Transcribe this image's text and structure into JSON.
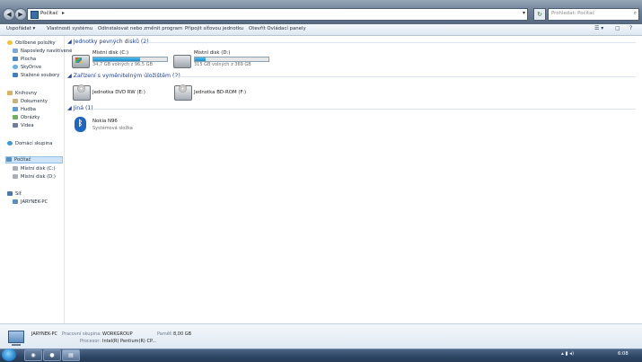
{
  "window": {
    "address": {
      "location": "Počítač",
      "separator": "▸",
      "dropdown": "▾"
    },
    "refresh_glyph": "↻",
    "search": {
      "placeholder": "Prohledat: Počítač",
      "icon": "search-icon"
    },
    "nav": {
      "back": "◀",
      "forward": "▶"
    }
  },
  "toolbar": {
    "items": [
      {
        "label": "Uspořádat ▾"
      },
      {
        "label": "Vlastnosti systému"
      },
      {
        "label": "Odinstalovat nebo změnit program"
      },
      {
        "label": "Připojit síťovou jednotku"
      },
      {
        "label": "Otevřít Ovládací panely"
      }
    ],
    "right": {
      "view": "☰ ▾",
      "preview": "▢",
      "help": "?"
    }
  },
  "sidebar": {
    "favorites": {
      "title": "Oblíbené položky",
      "items": [
        {
          "label": "Naposledy navštívené"
        },
        {
          "label": "Plocha"
        },
        {
          "label": "SkyDrive"
        },
        {
          "label": "Stažené soubory"
        }
      ]
    },
    "libraries": {
      "title": "Knihovny",
      "items": [
        {
          "label": "Dokumenty"
        },
        {
          "label": "Hudba"
        },
        {
          "label": "Obrázky"
        },
        {
          "label": "Videa"
        }
      ]
    },
    "homegroup": {
      "title": "Domácí skupina"
    },
    "computer": {
      "title": "Počítač",
      "items": [
        {
          "label": "Místní disk (C:)"
        },
        {
          "label": "Místní disk (D:)"
        }
      ]
    },
    "network": {
      "title": "Síť",
      "items": [
        {
          "label": "JARYNEK-PC"
        }
      ]
    }
  },
  "groups": {
    "hard_drives": {
      "header": "Jednotky pevných disků (2)",
      "drives": [
        {
          "name": "Místní disk (C:)",
          "free": "34,7 GB volných z 96,5 GB",
          "used_fraction": 0.64
        },
        {
          "name": "Místní disk (D:)",
          "free": "315 GB volných z 369 GB",
          "used_fraction": 0.15
        }
      ]
    },
    "removable": {
      "header": "Zařízení s vyměnitelným úložištěm (2)",
      "devices": [
        {
          "name": "Jednotka DVD RW (E:)"
        },
        {
          "name": "Jednotka BD-ROM (F:)"
        }
      ]
    },
    "other": {
      "header": "Jiná (1)",
      "items": [
        {
          "name": "Nokia N96",
          "type": "Systémová složka",
          "glyph": "ᛒ"
        }
      ]
    }
  },
  "details": {
    "computer_name": "JARYNEK-PC",
    "workgroup_label": "Pracovní skupina:",
    "workgroup": "WORKGROUP",
    "memory_label": "Paměť:",
    "memory": "8,00 GB",
    "processor_label": "Procesor:",
    "processor": "Intel(R) Pentium(R) CP..."
  },
  "taskbar": {
    "clock": "6:08",
    "tray_icons": "▴ ▮ ◂)"
  },
  "colors": {
    "group_header": "#1e3f9a",
    "drive_bar": "#1f89c8",
    "selection": "#cde3f7"
  }
}
